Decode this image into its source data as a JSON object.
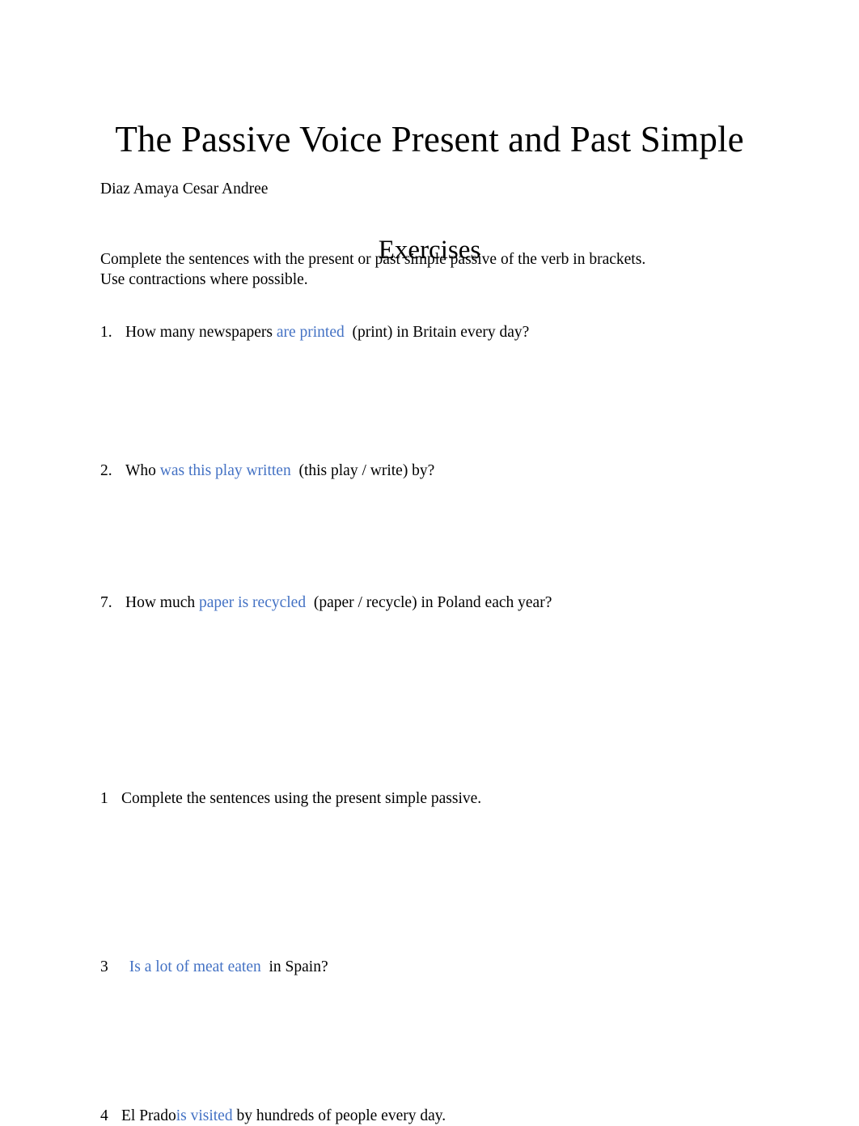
{
  "document": {
    "title": "The Passive Voice Present and Past Simple",
    "author": "Diaz Amaya Cesar Andree",
    "accent_color": "#4472C4",
    "text_color": "#000000",
    "background_color": "#FFFFFF"
  },
  "section_exercises": {
    "heading": "Exercises",
    "instructions": {
      "line1": "Complete the sentences with the present or past simple passive of the verb in brackets.",
      "line2": "Use contractions where possible."
    },
    "items": [
      {
        "number": "1.",
        "prefix": "How many newspapers ",
        "answer": "are printed",
        "suffix": "  (print) in Britain every day?"
      },
      {
        "number": "2.",
        "prefix": "Who ",
        "answer": "was this play written",
        "suffix": "  (this play / write) by?"
      },
      {
        "number": "7.",
        "prefix": "How much ",
        "answer": "paper is recycled",
        "suffix": "  (paper / recycle) in Poland each year?"
      }
    ]
  },
  "section_present_simple": {
    "items": [
      {
        "number": "1",
        "prefix": "Complete the sentences using the present simple passive.",
        "answer": "",
        "suffix": ""
      },
      {
        "number": "3",
        "prefix": "  ",
        "answer": "Is a lot of meat eaten",
        "suffix": "  in Spain?"
      },
      {
        "number": "4",
        "prefix": "El Prado",
        "answer": "is visited",
        "suffix": " by hundreds of people every day."
      }
    ]
  }
}
